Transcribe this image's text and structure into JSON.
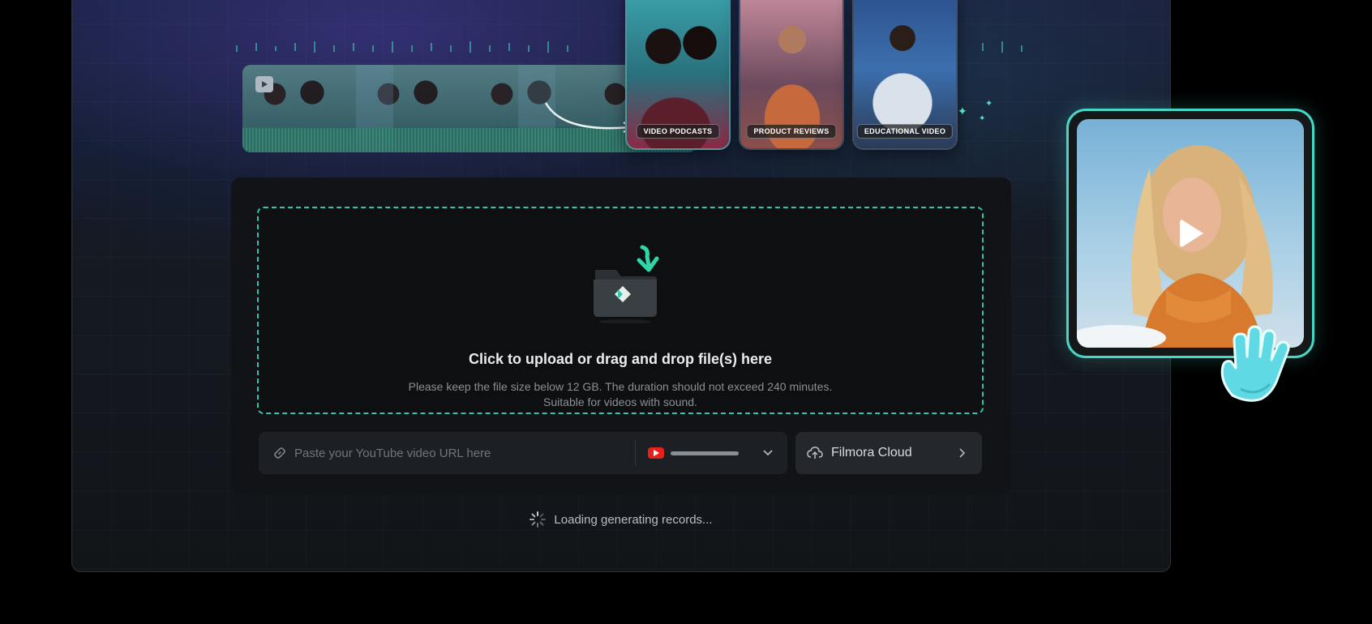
{
  "banner": {
    "categories": [
      {
        "label": "VIDEO PODCASTS"
      },
      {
        "label": "PRODUCT REVIEWS"
      },
      {
        "label": "EDUCATIONAL VIDEO"
      }
    ]
  },
  "upload": {
    "title": "Click to upload or drag and drop file(s) here",
    "hint_line1": "Please keep the file size below 12 GB. The duration should not exceed 240 minutes.",
    "hint_line2": "Suitable for videos with sound."
  },
  "url_input": {
    "placeholder": "Paste your YouTube video URL here",
    "value": ""
  },
  "cloud": {
    "label": "Filmora Cloud"
  },
  "status": {
    "loading_text": "Loading generating records..."
  },
  "colors": {
    "accent": "#2fc6ad",
    "youtube": "#e62117",
    "card_border": "#46d8c6"
  }
}
